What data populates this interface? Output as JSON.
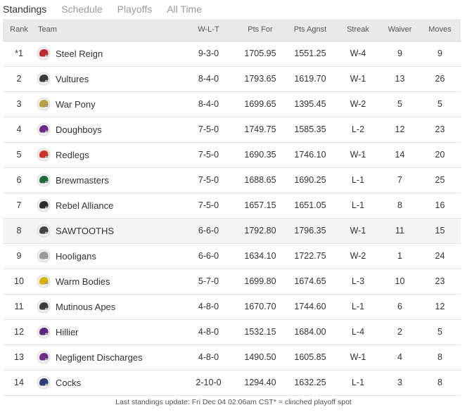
{
  "tabs": [
    {
      "label": "Standings",
      "active": true
    },
    {
      "label": "Schedule",
      "active": false
    },
    {
      "label": "Playoffs",
      "active": false
    },
    {
      "label": "All Time",
      "active": false
    }
  ],
  "table": {
    "headers": {
      "rank": "Rank",
      "team": "Team",
      "wlt": "W-L-T",
      "pts_for": "Pts For",
      "pts_agnst": "Pts Agnst",
      "streak": "Streak",
      "waiver": "Waiver",
      "moves": "Moves"
    },
    "rows": [
      {
        "rank": "*1",
        "team": "Steel Reign",
        "icon": "red-helmet-icon",
        "color": "#c0282d",
        "wlt": "9-3-0",
        "pts_for": "1705.95",
        "pts_agnst": "1551.25",
        "streak": "W-4",
        "waiver": "9",
        "moves": "9"
      },
      {
        "rank": "2",
        "team": "Vultures",
        "icon": "vulture-wings-icon",
        "color": "#3a3a3a",
        "wlt": "8-4-0",
        "pts_for": "1793.65",
        "pts_agnst": "1619.70",
        "streak": "W-1",
        "waiver": "13",
        "moves": "26"
      },
      {
        "rank": "3",
        "team": "War Pony",
        "icon": "gold-helmet-icon",
        "color": "#b8a040",
        "wlt": "8-4-0",
        "pts_for": "1699.65",
        "pts_agnst": "1395.45",
        "streak": "W-2",
        "waiver": "5",
        "moves": "5"
      },
      {
        "rank": "4",
        "team": "Doughboys",
        "icon": "purple-helmet-icon",
        "color": "#6a2a8c",
        "wlt": "7-5-0",
        "pts_for": "1749.75",
        "pts_agnst": "1585.35",
        "streak": "L-2",
        "waiver": "12",
        "moves": "23"
      },
      {
        "rank": "5",
        "team": "Redlegs",
        "icon": "red-shield-icon",
        "color": "#d0322a",
        "wlt": "7-5-0",
        "pts_for": "1690.35",
        "pts_agnst": "1746.10",
        "streak": "W-1",
        "waiver": "14",
        "moves": "20"
      },
      {
        "rank": "6",
        "team": "Brewmasters",
        "icon": "green-helmet-icon",
        "color": "#1f6b3a",
        "wlt": "7-5-0",
        "pts_for": "1688.65",
        "pts_agnst": "1690.25",
        "streak": "L-1",
        "waiver": "7",
        "moves": "25"
      },
      {
        "rank": "7",
        "team": "Rebel Alliance",
        "icon": "dark-emblem-icon",
        "color": "#2b2b2b",
        "wlt": "7-5-0",
        "pts_for": "1657.15",
        "pts_agnst": "1651.05",
        "streak": "L-1",
        "waiver": "8",
        "moves": "16"
      },
      {
        "rank": "8",
        "team": "SAWTOOTHS",
        "icon": "sawtooth-logo-icon",
        "color": "#444444",
        "wlt": "6-6-0",
        "pts_for": "1792.80",
        "pts_agnst": "1796.35",
        "streak": "W-1",
        "waiver": "11",
        "moves": "15",
        "highlight": true
      },
      {
        "rank": "9",
        "team": "Hooligans",
        "icon": "silver-helmet-icon",
        "color": "#9a9a9a",
        "wlt": "6-6-0",
        "pts_for": "1634.10",
        "pts_agnst": "1722.75",
        "streak": "W-2",
        "waiver": "1",
        "moves": "24"
      },
      {
        "rank": "10",
        "team": "Warm Bodies",
        "icon": "yellow-helmet-icon",
        "color": "#d9b300",
        "wlt": "5-7-0",
        "pts_for": "1699.80",
        "pts_agnst": "1674.65",
        "streak": "L-3",
        "waiver": "10",
        "moves": "23"
      },
      {
        "rank": "11",
        "team": "Mutinous Apes",
        "icon": "ape-skull-icon",
        "color": "#3c3c3c",
        "wlt": "4-8-0",
        "pts_for": "1670.70",
        "pts_agnst": "1744.60",
        "streak": "L-1",
        "waiver": "6",
        "moves": "12"
      },
      {
        "rank": "12",
        "team": "Hillier",
        "icon": "purple-helmet-icon",
        "color": "#5a2a82",
        "wlt": "4-8-0",
        "pts_for": "1532.15",
        "pts_agnst": "1684.00",
        "streak": "L-4",
        "waiver": "2",
        "moves": "5"
      },
      {
        "rank": "13",
        "team": "Negligent Discharges",
        "icon": "violet-helmet-icon",
        "color": "#6b2d8a",
        "wlt": "4-8-0",
        "pts_for": "1490.50",
        "pts_agnst": "1605.85",
        "streak": "W-1",
        "waiver": "4",
        "moves": "8"
      },
      {
        "rank": "14",
        "team": "Cocks",
        "icon": "navy-helmet-icon",
        "color": "#2a3f7a",
        "wlt": "2-10-0",
        "pts_for": "1294.40",
        "pts_agnst": "1632.25",
        "streak": "L-1",
        "waiver": "3",
        "moves": "8"
      }
    ]
  },
  "footer": "Last standings update: Fri Dec 04 02:06am CST* = clinched playoff spot"
}
